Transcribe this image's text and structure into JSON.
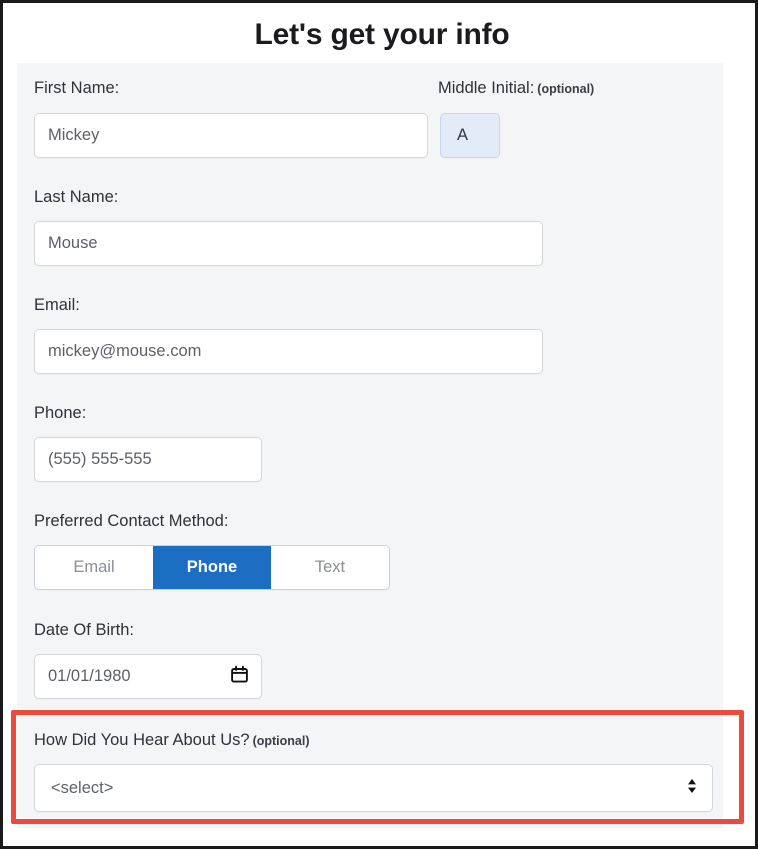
{
  "header": {
    "title": "Let's get your info"
  },
  "colors": {
    "accent_blue": "#1b6ec2",
    "annotation_red": "#ea4b3c",
    "initial_field_fill": "#e3ebf9",
    "panel_background": "#f4f5f6",
    "page_background": "#ffffff",
    "frame_border": "#1a1a1a"
  },
  "form": {
    "first_name": {
      "label": "First Name:",
      "value": "Mickey"
    },
    "middle_initial": {
      "label": "Middle Initial:",
      "optional": "(optional)",
      "value": "A"
    },
    "last_name": {
      "label": "Last Name:",
      "value": "Mouse"
    },
    "email": {
      "label": "Email:",
      "value": "mickey@mouse.com"
    },
    "phone": {
      "label": "Phone:",
      "value": "(555) 555-555"
    },
    "contact_method": {
      "label": "Preferred Contact Method:",
      "options": [
        {
          "label": "Email",
          "selected": false
        },
        {
          "label": "Phone",
          "selected": true
        },
        {
          "label": "Text",
          "selected": false
        }
      ],
      "selected": "Phone"
    },
    "date_of_birth": {
      "label": "Date Of Birth:",
      "value": "01/01/1980",
      "icon": "calendar-icon"
    },
    "referral_source": {
      "label": "How Did You Hear About Us?",
      "optional": "(optional)",
      "value": "<select>",
      "icon": "up-down-arrows-icon"
    }
  }
}
